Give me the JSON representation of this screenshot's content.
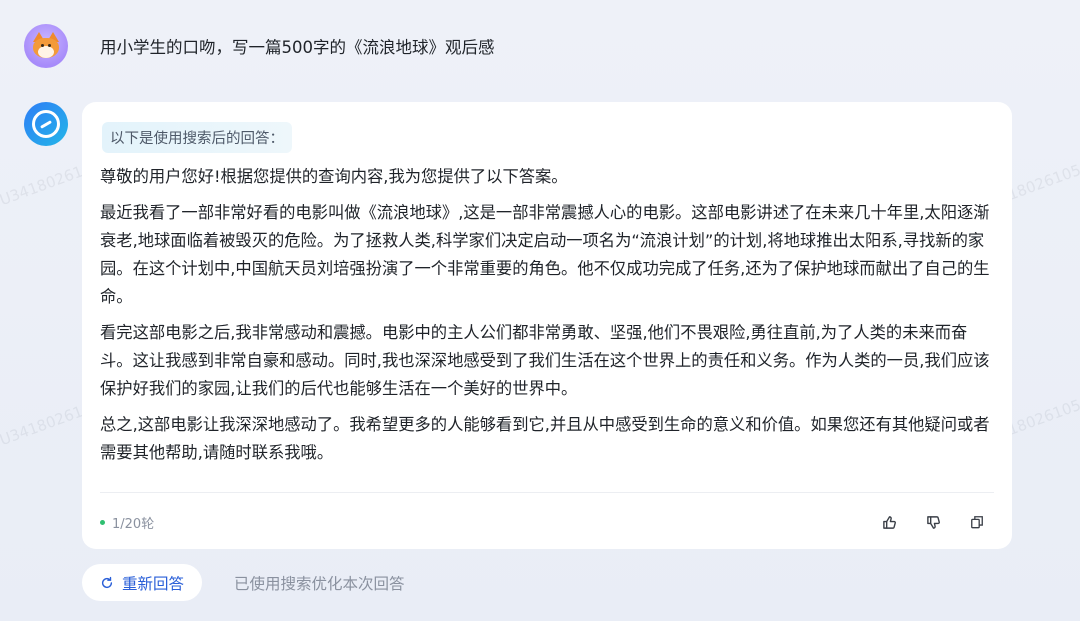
{
  "user": {
    "message": "用小学生的口吻，写一篇500字的《流浪地球》观后感"
  },
  "answer": {
    "search_notice": "以下是使用搜索后的回答：",
    "paragraphs": [
      "尊敬的用户您好!根据您提供的查询内容,我为您提供了以下答案。",
      "最近我看了一部非常好看的电影叫做《流浪地球》,这是一部非常震撼人心的电影。这部电影讲述了在未来几十年里,太阳逐渐衰老,地球面临着被毁灭的危险。为了拯救人类,科学家们决定启动一项名为“流浪计划”的计划,将地球推出太阳系,寻找新的家园。在这个计划中,中国航天员刘培强扮演了一个非常重要的角色。他不仅成功完成了任务,还为了保护地球而献出了自己的生命。",
      "看完这部电影之后,我非常感动和震撼。电影中的主人公们都非常勇敢、坚强,他们不畏艰险,勇往直前,为了人类的未来而奋斗。这让我感到非常自豪和感动。同时,我也深深地感受到了我们生活在这个世界上的责任和义务。作为人类的一员,我们应该保护好我们的家园,让我们的后代也能够生活在一个美好的世界中。",
      "总之,这部电影让我深深地感动了。我希望更多的人能够看到它,并且从中感受到生命的意义和价值。如果您还有其他疑问或者需要其他帮助,请随时联系我哦。"
    ],
    "round_count": "1/20轮"
  },
  "controls": {
    "regenerate_label": "重新回答",
    "search_note": "已使用搜索优化本次回答"
  },
  "watermark": "3600U3418026105",
  "icons": {
    "user_avatar": "fox-avatar-icon",
    "bot_avatar": "assistant-logo-icon",
    "like": "thumbs-up-icon",
    "dislike": "thumbs-down-icon",
    "copy": "copy-icon",
    "regenerate": "refresh-icon"
  },
  "colors": {
    "accent": "#2a5fd8",
    "status_dot": "#2fbf71"
  }
}
